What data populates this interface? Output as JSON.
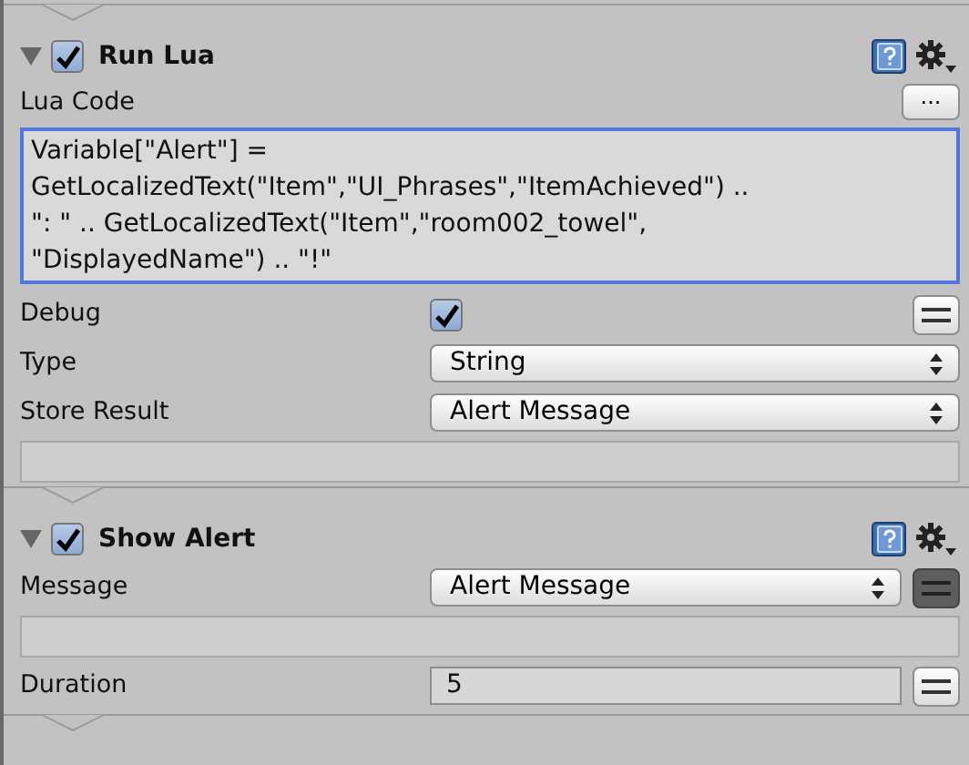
{
  "components": [
    {
      "title": "Run Lua",
      "expanded": true,
      "enabled": true,
      "fields": [
        {
          "kind": "code",
          "label": "Lua Code",
          "button": "...",
          "value": "Variable[\"Alert\"] =\nGetLocalizedText(\"Item\",\"UI_Phrases\",\"ItemAchieved\") ..\n\": \" .. GetLocalizedText(\"Item\",\"room002_towel\",\n\"DisplayedName\") .. \"!\""
        },
        {
          "kind": "checkbox",
          "label": "Debug",
          "checked": true,
          "toggle_on": false
        },
        {
          "kind": "dropdown",
          "label": "Type",
          "value": "String"
        },
        {
          "kind": "dropdown",
          "label": "Store Result",
          "value": "Alert Message"
        },
        {
          "kind": "blank"
        }
      ]
    },
    {
      "title": "Show Alert",
      "expanded": true,
      "enabled": true,
      "fields": [
        {
          "kind": "dropdown",
          "label": "Message",
          "value": "Alert Message",
          "toggle_on": true
        },
        {
          "kind": "blank"
        },
        {
          "kind": "number",
          "label": "Duration",
          "value": "5",
          "toggle_on": false
        }
      ]
    }
  ]
}
